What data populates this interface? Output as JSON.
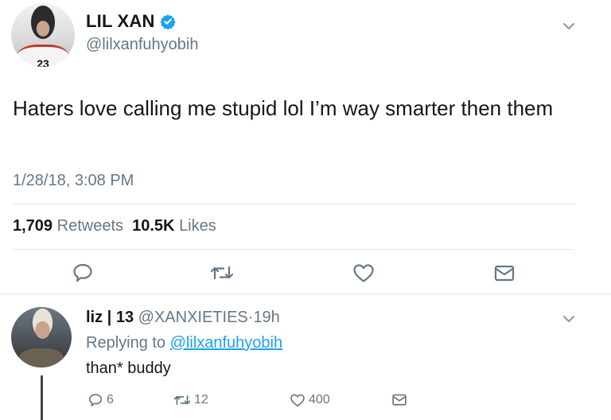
{
  "tweet": {
    "display_name": "LIL XAN",
    "verified": true,
    "handle": "@lilxanfuhyobih",
    "text": "Haters love calling me stupid lol I’m way smarter then them",
    "timestamp": "1/28/18, 3:08 PM",
    "retweets_count": "1,709",
    "retweets_label": "Retweets",
    "likes_count": "10.5K",
    "likes_label": "Likes",
    "shirt_number": "23"
  },
  "reply": {
    "display_name": "liz | 13",
    "handle": "@XANXIETIES",
    "separator": "·",
    "time": "19h",
    "replying_prefix": "Replying to",
    "replying_to": "@lilxanfuhyobih",
    "text": "than* buddy",
    "reply_count": "6",
    "retweet_count": "12",
    "like_count": "400"
  },
  "icons": {
    "verified": "verified-badge-icon",
    "menu": "chevron-down-icon",
    "reply": "reply-icon",
    "retweet": "retweet-icon",
    "like": "heart-icon",
    "dm": "direct-message-icon"
  },
  "colors": {
    "accent": "#1da1f2",
    "text": "#14171a",
    "secondary": "#657786",
    "divider": "#e1e8ed"
  }
}
